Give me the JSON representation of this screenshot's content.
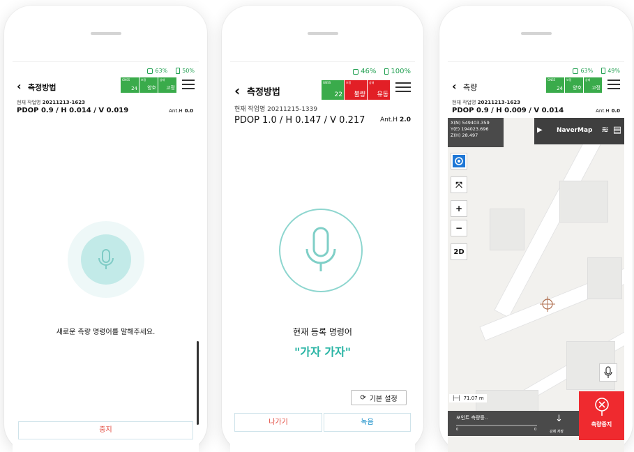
{
  "phone1": {
    "status": {
      "signal": "63%",
      "battery": "50%"
    },
    "title": "측정방법",
    "badges": [
      {
        "top": "GNSS",
        "value": "24",
        "color": "#3aab4b"
      },
      {
        "top": "보정",
        "value": "양호",
        "color": "#3aab4b"
      },
      {
        "top": "상태",
        "value": "고정",
        "color": "#3aab4b"
      }
    ],
    "work_label": "현재 작업명",
    "work_name": "20211213-1623",
    "pdop": "PDOP 0.9 / H 0.014 / V 0.019",
    "ant_label": "Ant.H",
    "ant_value": "0.0",
    "prompt": "새로운 측량 명령어를 말해주세요.",
    "stop_label": "중지"
  },
  "phone2": {
    "status": {
      "signal": "46%",
      "battery": "100%"
    },
    "title": "측정방법",
    "badges": [
      {
        "top": "GNSS",
        "value": "22",
        "color": "#3aab4b"
      },
      {
        "top": "보정",
        "value": "불량",
        "color": "#e21f26"
      },
      {
        "top": "상태",
        "value": "유동",
        "color": "#e21f26"
      }
    ],
    "work_label": "현재 작업명",
    "work_name": "20211215-1339",
    "pdop": "PDOP 1.0 / H 0.147 / V 0.217",
    "ant_label": "Ant.H",
    "ant_value": "2.0",
    "registered_label": "현재 등록 명령어",
    "command": "\"가자 가자\"",
    "reset_label": "기본 설정",
    "exit_label": "나가기",
    "record_label": "녹음"
  },
  "phone3": {
    "status": {
      "signal": "63%",
      "battery": "49%"
    },
    "title": "측량",
    "badges": [
      {
        "top": "GNSS",
        "value": "24",
        "color": "#3aab4b"
      },
      {
        "top": "보정",
        "value": "양호",
        "color": "#3aab4b"
      },
      {
        "top": "상태",
        "value": "고정",
        "color": "#3aab4b"
      }
    ],
    "work_label": "현재 작업명",
    "work_name": "20211213-1623",
    "pdop": "PDOP 0.9 / H 0.009 / V 0.014",
    "ant_label": "Ant.H",
    "ant_value": "0.0",
    "coords": {
      "x": "X(N) 549403.359",
      "y": "Y(E) 194023.696",
      "z": "Z(H) 28.497"
    },
    "map_provider": "NaverMap",
    "zoom_in": "+",
    "zoom_out": "−",
    "mode_2d": "2D",
    "scale": "71.07 m",
    "point_status": "포인트 측량중..",
    "progress_min": "0",
    "progress_max": "0",
    "save_label": "강제 저장",
    "stop_survey_label": "측량중지"
  }
}
